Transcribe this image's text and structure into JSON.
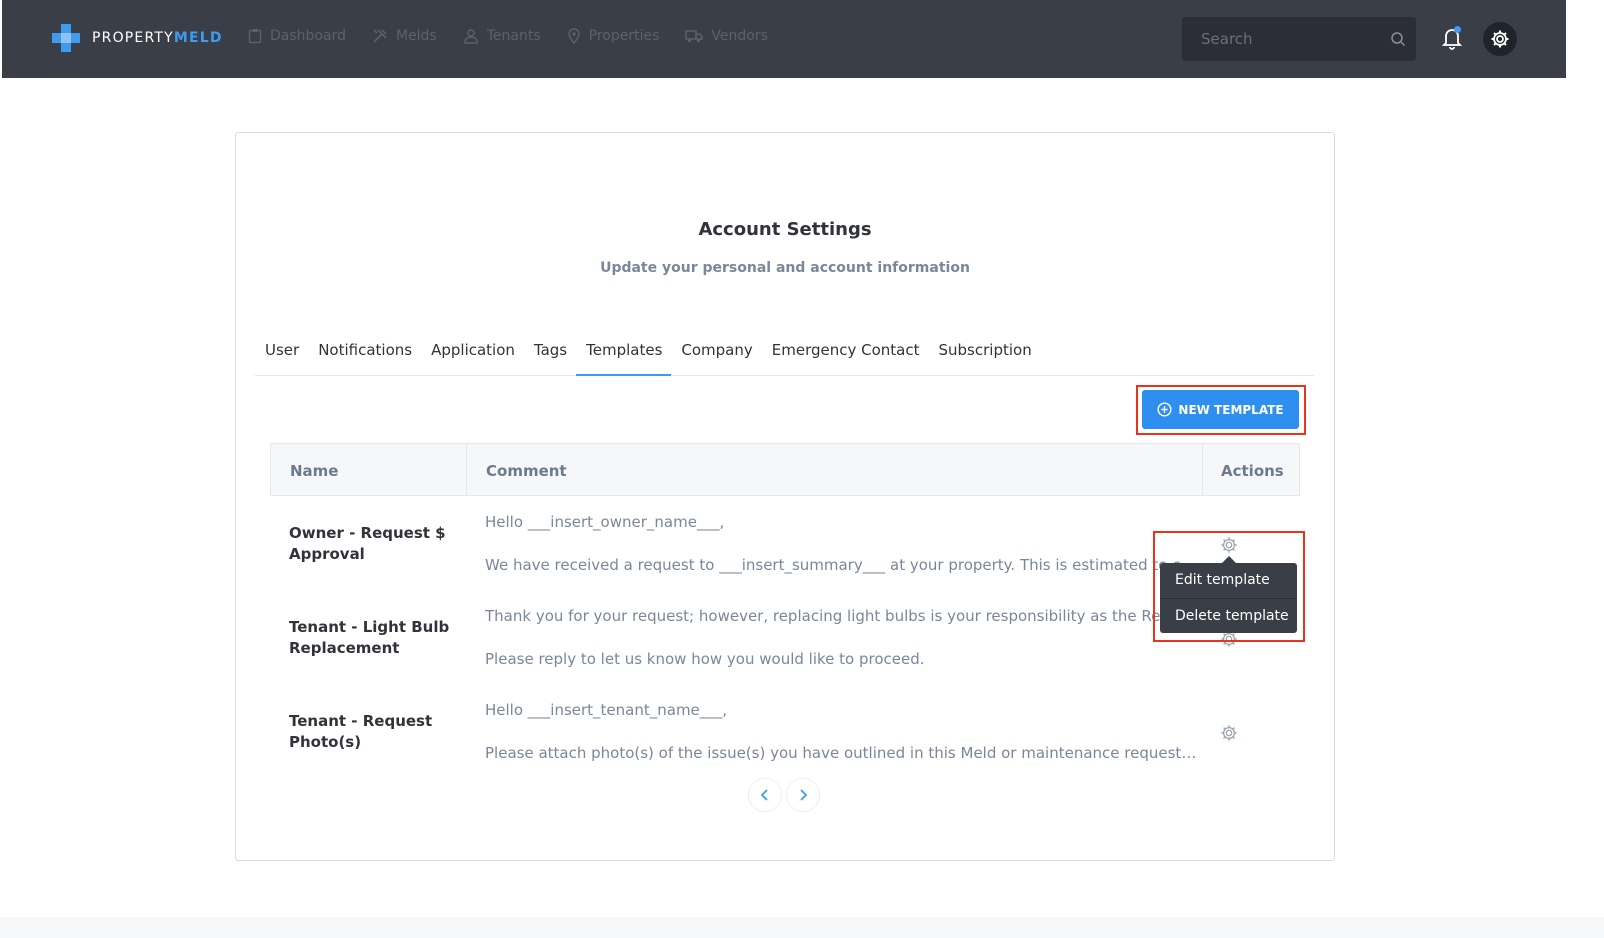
{
  "app": {
    "brand_plain": "PROPERTY",
    "brand_accent": "MELD"
  },
  "nav": {
    "items": [
      {
        "label": "Dashboard",
        "icon": "clipboard-icon"
      },
      {
        "label": "Melds",
        "icon": "tools-icon"
      },
      {
        "label": "Tenants",
        "icon": "person-icon"
      },
      {
        "label": "Properties",
        "icon": "location-pin-icon"
      },
      {
        "label": "Vendors",
        "icon": "truck-icon"
      }
    ],
    "search_placeholder": "Search"
  },
  "page": {
    "title": "Account Settings",
    "subtitle": "Update your personal and account information"
  },
  "tabs": [
    {
      "label": "User",
      "active": false
    },
    {
      "label": "Notifications",
      "active": false
    },
    {
      "label": "Application",
      "active": false
    },
    {
      "label": "Tags",
      "active": false
    },
    {
      "label": "Templates",
      "active": true
    },
    {
      "label": "Company",
      "active": false
    },
    {
      "label": "Emergency Contact",
      "active": false
    },
    {
      "label": "Subscription",
      "active": false
    }
  ],
  "new_template_label": "NEW TEMPLATE",
  "table": {
    "headers": {
      "name": "Name",
      "comment": "Comment",
      "actions": "Actions"
    },
    "rows": [
      {
        "name": "Owner - Request $ Approval",
        "comment_line1": "Hello ___insert_owner_name___,",
        "comment_line2": "We have received a request to ___insert_summary___ at your property.  This is estimated to cost"
      },
      {
        "name": "Tenant - Light Bulb Replacement",
        "comment_line1": "Thank you for your request; however, replacing light bulbs is your responsibility as the Resident",
        "comment_line2": "Please reply to let us know how you would like to proceed."
      },
      {
        "name": "Tenant - Request Photo(s)",
        "comment_line1": "Hello ___insert_tenant_name___,",
        "comment_line2": "Please attach photo(s) of the issue(s) you have outlined in this Meld or maintenance request.  Th..."
      }
    ]
  },
  "dropdown": {
    "items": [
      "Edit template",
      "Delete template"
    ]
  },
  "colors": {
    "accent": "#2f8ff0",
    "navbar": "#3a3e47",
    "highlight": "#e8341c"
  }
}
